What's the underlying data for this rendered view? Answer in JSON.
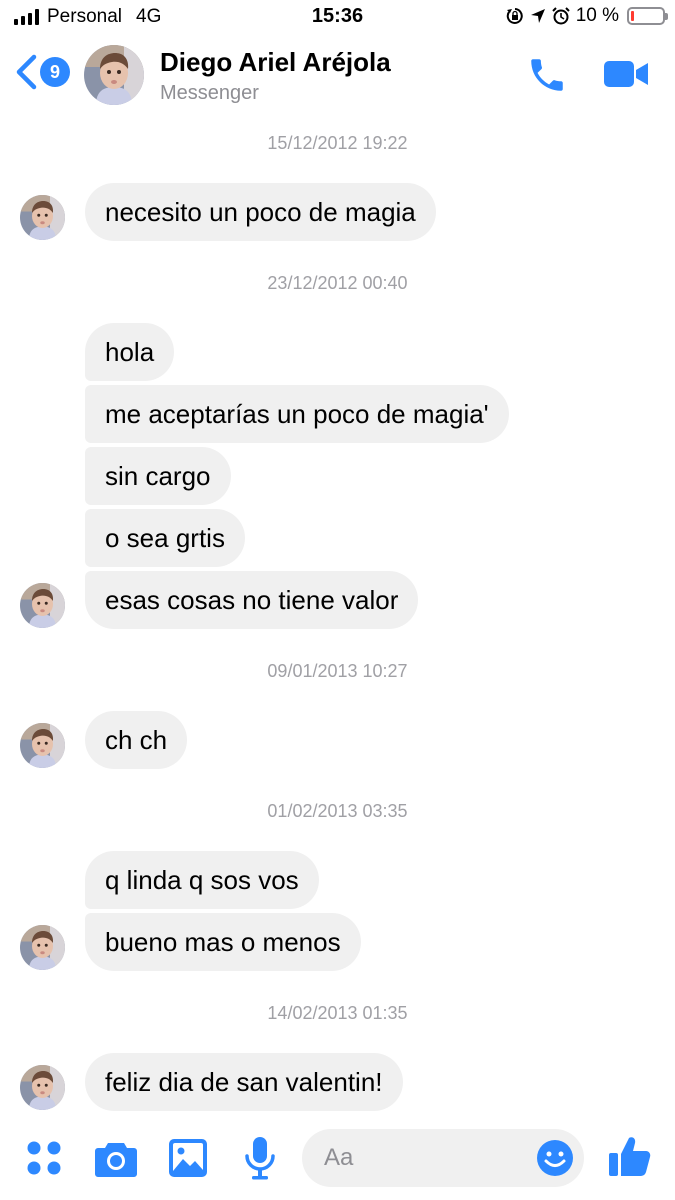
{
  "status_bar": {
    "carrier": "Personal",
    "network": "4G",
    "time": "15:36",
    "battery_percent": "10 %",
    "battery_level": 0.1,
    "icons": [
      "signal-icon",
      "lock-rotation-icon",
      "location-arrow-icon",
      "alarm-icon",
      "battery-icon"
    ]
  },
  "header": {
    "back_badge": "9",
    "contact_name": "Diego Ariel Aréjola",
    "subtitle": "Messenger",
    "icons": [
      "back-chevron-icon",
      "phone-icon",
      "video-camera-icon"
    ],
    "accent_color": "#2d88ff"
  },
  "conversation": [
    {
      "timestamp": "15/12/2012 19:22",
      "messages": [
        "necesito un poco de magia"
      ]
    },
    {
      "timestamp": "23/12/2012 00:40",
      "messages": [
        "hola",
        "me aceptarías un poco de magia'",
        "sin cargo",
        "o sea grtis",
        "esas cosas no tiene valor"
      ]
    },
    {
      "timestamp": "09/01/2013 10:27",
      "messages": [
        "ch ch"
      ]
    },
    {
      "timestamp": "01/02/2013 03:35",
      "messages": [
        "q linda q sos vos",
        "bueno mas o menos"
      ]
    },
    {
      "timestamp": "14/02/2013 01:35",
      "messages": [
        "feliz dia de san valentin!"
      ]
    }
  ],
  "composer": {
    "placeholder": "Aa",
    "value": "",
    "icons": [
      "apps-dots-icon",
      "camera-icon",
      "photo-icon",
      "microphone-icon",
      "emoji-icon",
      "thumbs-up-icon"
    ]
  },
  "colors": {
    "bubble": "#f0f0f0",
    "timestamp": "#a0a0a5",
    "accent": "#2d88ff"
  }
}
